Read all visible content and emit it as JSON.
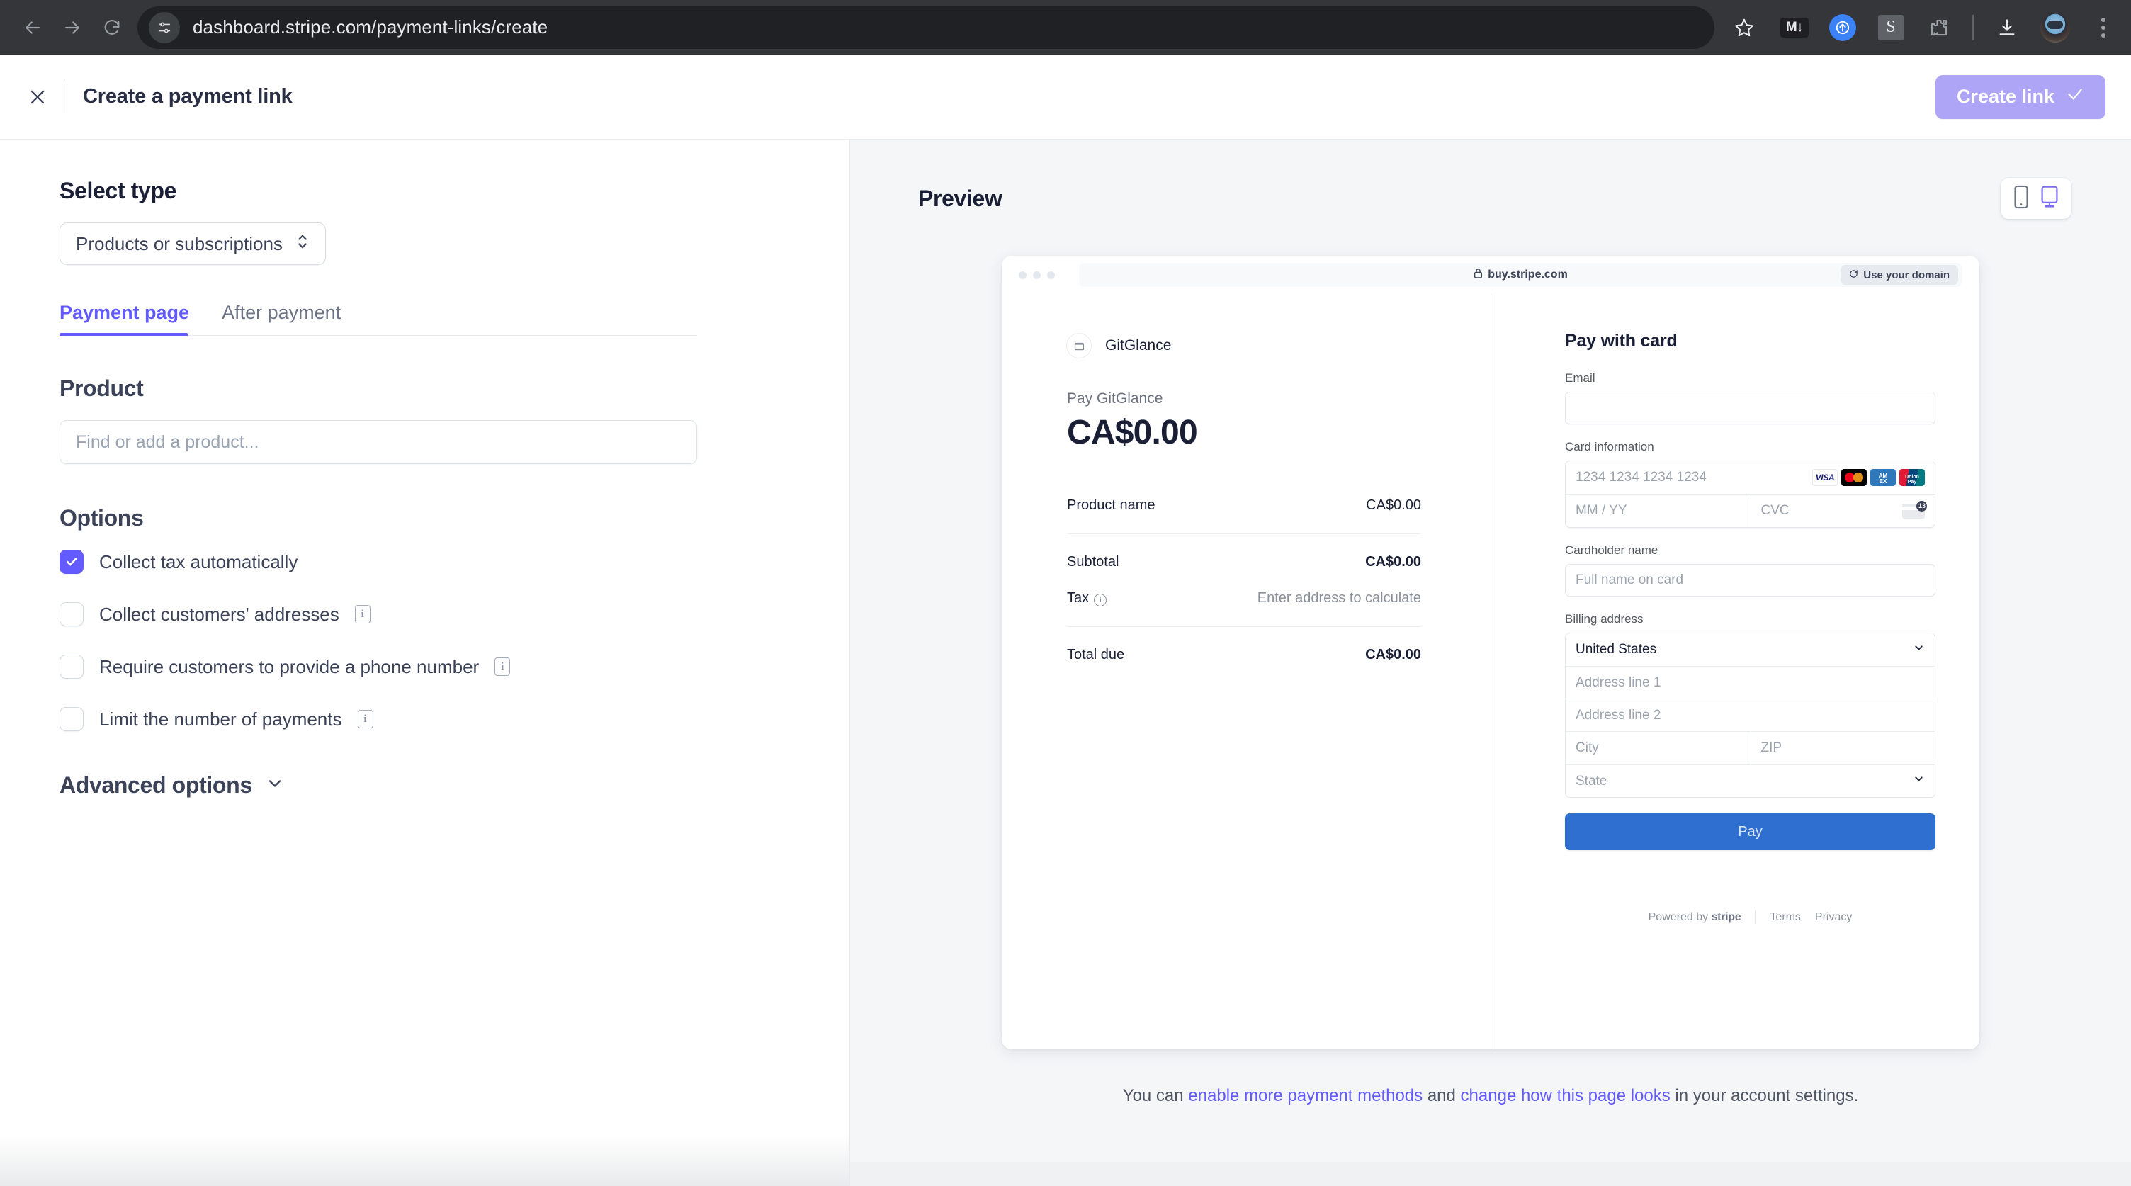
{
  "browser": {
    "url": "dashboard.stripe.com/payment-links/create",
    "back_icon": "back-arrow-icon",
    "forward_icon": "forward-arrow-icon",
    "reload_icon": "reload-icon",
    "site_info_icon": "site-settings-icon",
    "bookmark_icon": "star-icon",
    "extensions": [
      "markdown-download-extension",
      "upload-extension",
      "stripe-extension",
      "puzzle-extension"
    ],
    "download_icon": "download-icon",
    "profile_icon": "profile-avatar",
    "menu_icon": "kebab-menu-icon",
    "md_badge": "M"
  },
  "header": {
    "close_icon": "close-icon",
    "title": "Create a payment link",
    "create_button": "Create link",
    "create_button_color": "#afa5f7"
  },
  "left": {
    "select_type_heading": "Select type",
    "select_type_value": "Products or subscriptions",
    "tabs": [
      {
        "label": "Payment page",
        "active": true
      },
      {
        "label": "After payment",
        "active": false
      }
    ],
    "product_heading": "Product",
    "product_placeholder": "Find or add a product...",
    "options_heading": "Options",
    "options": [
      {
        "label": "Collect tax automatically",
        "checked": true,
        "info": false
      },
      {
        "label": "Collect customers' addresses",
        "checked": false,
        "info": true
      },
      {
        "label": "Require customers to provide a phone number",
        "checked": false,
        "info": true
      },
      {
        "label": "Limit the number of payments",
        "checked": false,
        "info": true
      }
    ],
    "advanced_options": "Advanced options",
    "accent_color": "#635bff"
  },
  "preview": {
    "title": "Preview",
    "device_mobile_icon": "mobile-device-icon",
    "device_desktop_icon": "desktop-device-icon",
    "device_selected": "desktop",
    "browser_url": "buy.stripe.com",
    "lock_icon": "lock-icon",
    "use_domain_label": "Use your domain",
    "use_domain_icon": "refresh-domain-icon",
    "merchant_name": "GitGlance",
    "merchant_logo_icon": "storefront-icon",
    "pay_label": "Pay GitGlance",
    "pay_amount": "CA$0.00",
    "line_items": [
      {
        "label": "Product name",
        "amount": "CA$0.00",
        "bold": false
      }
    ],
    "subtotal_label": "Subtotal",
    "subtotal_amount": "CA$0.00",
    "tax_label": "Tax",
    "tax_info_icon": "info-circle-icon",
    "tax_value": "Enter address to calculate",
    "total_label": "Total due",
    "total_amount": "CA$0.00",
    "form": {
      "title": "Pay with card",
      "email_label": "Email",
      "email_value": "",
      "card_label": "Card information",
      "card_number_placeholder": "1234 1234 1234 1234",
      "expiry_placeholder": "MM / YY",
      "cvc_placeholder": "CVC",
      "card_brands": [
        "visa",
        "mastercard",
        "amex",
        "unionpay"
      ],
      "cvc_icon": "cvc-card-icon",
      "cardholder_label": "Cardholder name",
      "cardholder_placeholder": "Full name on card",
      "billing_label": "Billing address",
      "country_value": "United States",
      "address1_placeholder": "Address line 1",
      "address2_placeholder": "Address line 2",
      "city_placeholder": "City",
      "zip_placeholder": "ZIP",
      "state_placeholder": "State",
      "pay_button": "Pay",
      "pay_button_color": "#2f6fd0"
    },
    "footer": {
      "powered_by": "Powered by",
      "brand": "stripe",
      "terms": "Terms",
      "privacy": "Privacy"
    }
  },
  "help": {
    "prefix": "You can ",
    "link1": "enable more payment methods",
    "middle": " and ",
    "link2": "change how this page looks",
    "suffix": " in your account settings."
  }
}
